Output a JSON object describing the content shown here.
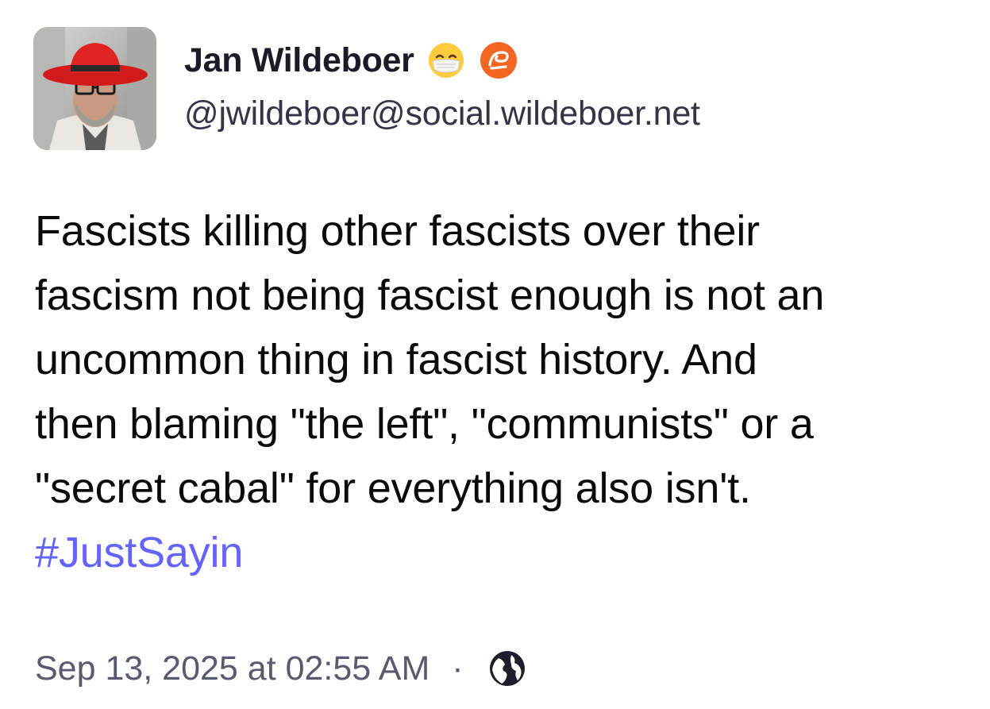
{
  "author": {
    "display_name": "Jan Wildeboer",
    "handle": "@jwildeboer@social.wildeboer.net",
    "avatar": "avatar-photo",
    "badges": [
      "mask-face-emoji",
      "orange-chat-emoji"
    ]
  },
  "post": {
    "lines": [
      "Fascists killing other fascists over their",
      "fascism not being fascist enough is not an",
      "uncommon thing in fascist history. And",
      "then blaming \"the left\", \"communists\" or a",
      "\"secret cabal\" for everything also isn't."
    ],
    "hashtag": "#JustSayin"
  },
  "meta": {
    "timestamp": "Sep 13, 2025 at 02:55 AM",
    "separator": "·",
    "visibility_icon": "globe-icon"
  },
  "colors": {
    "hashtag": "#6364ff",
    "name": "#1b1a26",
    "meta": "#5a5a6e"
  }
}
